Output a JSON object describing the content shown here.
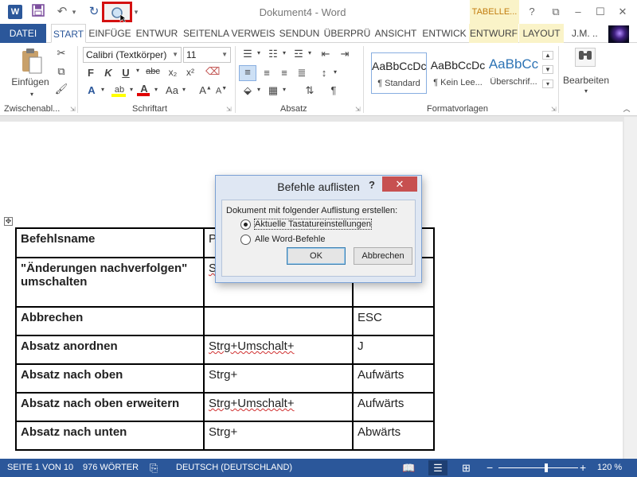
{
  "quick_access": {
    "app_icon": "word-icon",
    "app_letter": "W",
    "save_icon": "save-icon",
    "undo_icon": "undo-icon",
    "redo_icon": "redo-icon",
    "search_icon": "magnifier-icon",
    "more_icon": "chevron-down-icon"
  },
  "window": {
    "title": "Dokument4 - Word",
    "context_title": "TABELLE...",
    "help": "?",
    "minimize_icon": "minimize-icon",
    "maximize_icon": "maximize-icon",
    "close_icon": "close-icon"
  },
  "tabs": [
    {
      "label": "DATEI"
    },
    {
      "label": "START"
    },
    {
      "label": "EINFÜGE"
    },
    {
      "label": "ENTWUR"
    },
    {
      "label": "SEITENLA"
    },
    {
      "label": "VERWEIS"
    },
    {
      "label": "SENDUN"
    },
    {
      "label": "ÜBERPRÜ"
    },
    {
      "label": "ANSICHT"
    },
    {
      "label": "ENTWICK"
    },
    {
      "label": "ENTWURF"
    },
    {
      "label": "LAYOUT"
    }
  ],
  "active_tab": "START",
  "user": "J.M. ..",
  "ribbon": {
    "clipboard": {
      "paste_label": "Einfügen",
      "group_label": "Zwischenabl..."
    },
    "font": {
      "font_name": "Calibri (Textkörper)",
      "font_size": "11",
      "group_label": "Schriftart"
    },
    "paragraph": {
      "group_label": "Absatz"
    },
    "styles": {
      "group_label": "Formatvorlagen",
      "items": [
        {
          "sample": "AaBbCcDc",
          "name": "¶ Standard"
        },
        {
          "sample": "AaBbCcDc",
          "name": "¶ Kein Lee..."
        },
        {
          "sample": "AaBbCc",
          "name": "Überschrif..."
        }
      ]
    },
    "editing": {
      "label": "Bearbeiten"
    }
  },
  "table": {
    "rows": [
      {
        "name": "Befehlsname",
        "keys": "P",
        "key2": ""
      },
      {
        "name": "\"Änderungen nachverfolgen\" umschalten",
        "keys": "S",
        "key2": ""
      },
      {
        "name": "Abbrechen",
        "keys": "",
        "key2": "ESC"
      },
      {
        "name": "Absatz anordnen",
        "keys": "Strg+Umschalt+",
        "key2": "J"
      },
      {
        "name": "Absatz nach oben",
        "keys": "Strg+",
        "key2": "Aufwärts"
      },
      {
        "name": "Absatz nach oben erweitern",
        "keys": "Strg+Umschalt+",
        "key2": "Aufwärts"
      },
      {
        "name": "Absatz nach unten",
        "keys": "Strg+",
        "key2": "Abwärts"
      }
    ]
  },
  "dialog": {
    "title": "Befehle auflisten",
    "help": "?",
    "close": "✕",
    "prompt": "Dokument mit folgender Auflistung erstellen:",
    "options": [
      {
        "label": "Aktuelle Tastatureinstellungen",
        "selected": true
      },
      {
        "label": "Alle Word-Befehle",
        "selected": false
      }
    ],
    "ok": "OK",
    "cancel": "Abbrechen"
  },
  "status": {
    "page": "SEITE 1 VON 10",
    "words": "976 WÖRTER",
    "proofing_icon": "proofing-icon",
    "language": "DEUTSCH (DEUTSCHLAND)",
    "view_icons": [
      "read-mode-icon",
      "print-layout-icon",
      "web-layout-icon"
    ],
    "zoom_minus": "−",
    "zoom_plus": "+",
    "zoom": "120 %",
    "zoom_level_fraction": 0.6
  },
  "colors": {
    "accent": "#2b579a",
    "highlight_border": "#d41010",
    "context_tab": "#faf3c8",
    "dialog_close": "#c75050"
  }
}
